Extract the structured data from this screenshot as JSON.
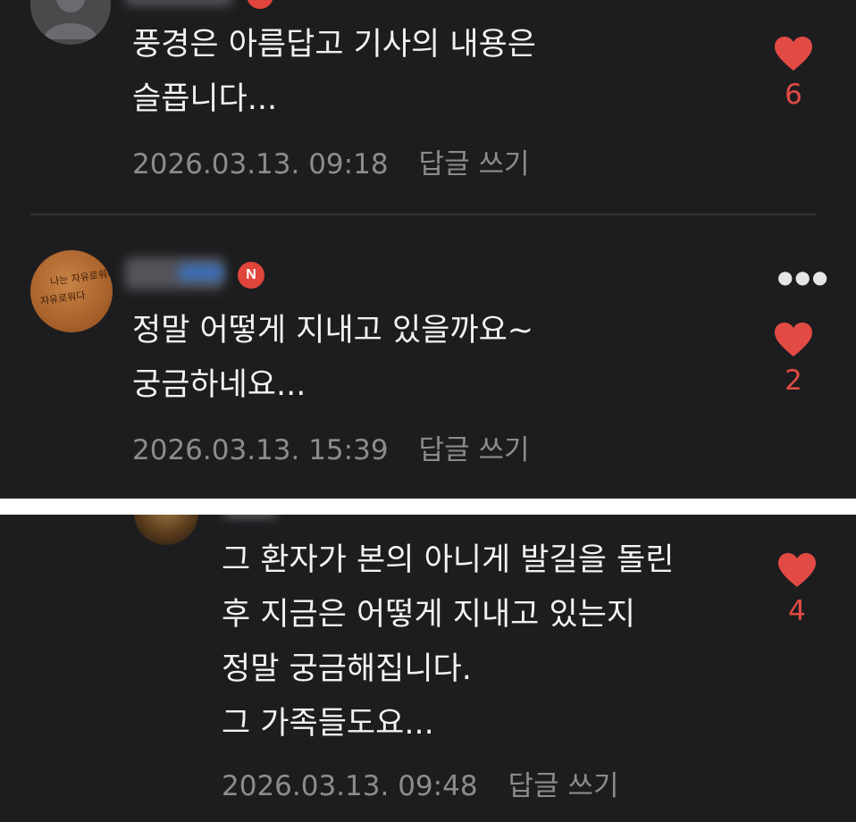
{
  "comments": [
    {
      "text_lines": [
        "풍경은 아름답고 기사의 내용은",
        "슬픕니다..."
      ],
      "timestamp": "2026.03.13. 09:18",
      "reply_label": "답글 쓰기",
      "likes": "6"
    },
    {
      "badge": "N",
      "text_lines": [
        "정말 어떻게 지내고 있을까요~",
        "궁금하네요..."
      ],
      "timestamp": "2026.03.13. 15:39",
      "reply_label": "답글 쓰기",
      "likes": "2",
      "more_icon": "more-horizontal-icon"
    },
    {
      "text_lines": [
        "그 환자가 본의 아니게 발길을 돌린",
        "후 지금은 어떻게 지내고 있는지",
        "정말 궁금해집니다.",
        "그 가족들도요..."
      ],
      "timestamp": "2026.03.13. 09:48",
      "reply_label": "답글 쓰기",
      "likes": "4"
    }
  ],
  "avatar_2_text": "나는 자유로워다",
  "colors": {
    "background": "#1d1d1f",
    "text": "#f2f2f2",
    "meta": "#8c8c8e",
    "like": "#e24a44",
    "badge": "#e0443a"
  }
}
